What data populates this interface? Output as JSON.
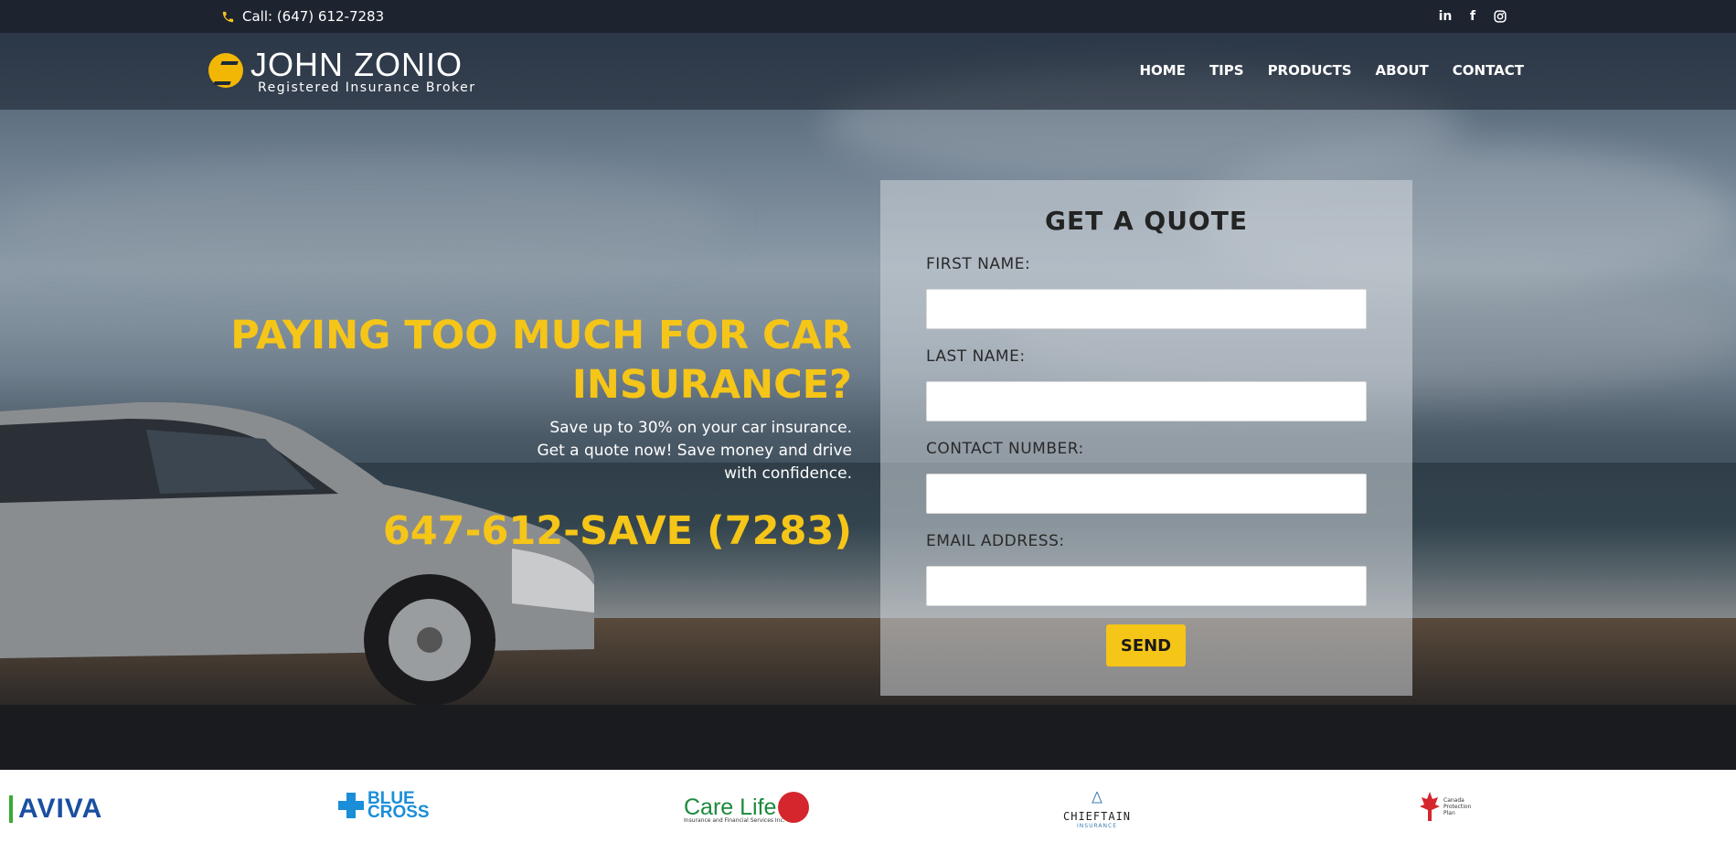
{
  "topbar": {
    "call_text": "Call: (647) 612-7283",
    "social": [
      "in",
      "f",
      "ig"
    ]
  },
  "brand": {
    "name": "JOHN ZONIO",
    "subtitle": "Registered Insurance Broker"
  },
  "nav": [
    "HOME",
    "TIPS",
    "PRODUCTS",
    "ABOUT",
    "CONTACT"
  ],
  "hero": {
    "headline_line1": "PAYING TOO MUCH FOR CAR",
    "headline_line2": "INSURANCE?",
    "tagline": "Save up to 30% on your car insurance. Get a quote now! Save money and drive with confidence.",
    "phone": "647-612-SAVE (7283)"
  },
  "quote_form": {
    "title": "GET A QUOTE",
    "first_name_label": "FIRST NAME:",
    "last_name_label": "LAST NAME:",
    "contact_label": "CONTACT NUMBER:",
    "email_label": "EMAIL ADDRESS:",
    "send_label": "SEND"
  },
  "partners": {
    "aviva": "AVIVA",
    "bluecross_1": "BLUE",
    "bluecross_2": "CROSS",
    "carelife": "Care Life",
    "carelife_sub": "Insurance and Financial Services Inc.",
    "chieftain": "CHIEFTAIN",
    "chieftain_sub": "INSURANCE",
    "canada_protection": "Canada Protection Plan"
  },
  "colors": {
    "accent": "#f5c518",
    "topbar": "#1e2330"
  }
}
